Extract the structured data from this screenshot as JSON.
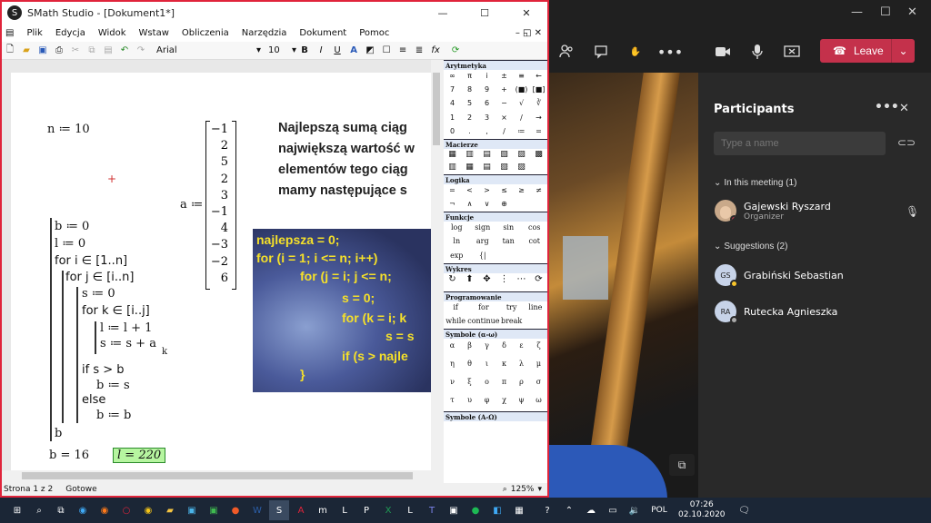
{
  "smath": {
    "title": "SMath Studio - [Dokument1*]",
    "menu": [
      "Plik",
      "Edycja",
      "Widok",
      "Wstaw",
      "Obliczenia",
      "Narzędzia",
      "Dokument",
      "Pomoc"
    ],
    "font_name": "Arial",
    "font_size": "10",
    "status_page": "Strona 1 z 2",
    "status_state": "Gotowe",
    "zoom": "125%",
    "math": {
      "n_def": "n ≔ 10",
      "a_label": "a ≔",
      "a_values": [
        "−1",
        "2",
        "5",
        "2",
        "3",
        "−1",
        "4",
        "−3",
        "−2",
        "6"
      ],
      "code": [
        "b ≔ 0",
        "l ≔ 0",
        "for  i ∈ [1..n]",
        "for  j ∈ [i..n]",
        "s ≔ 0",
        "for  k ∈ [i..j]",
        "l ≔ l + 1",
        "s ≔ s + a",
        "k",
        "if  s > b",
        "b ≔ s",
        "else",
        "b ≔ b",
        "b"
      ],
      "result_b": "b = 16",
      "result_l": "l = 220"
    },
    "slide_text": [
      "Najlepszą sumą ciąg",
      "największą wartość w",
      "elementów tego ciąg",
      "mamy następujące s"
    ],
    "slide_code": [
      "najlepsza = 0;",
      "for (i = 1; i <= n; i++)",
      "for (j = i; j <= n;",
      "s = 0;",
      "for (k = i; k",
      "s = s",
      "if (s > najle",
      "}"
    ],
    "palette": {
      "arytmetyka": {
        "title": "Arytmetyka",
        "rows": [
          "∞",
          "π",
          "i",
          "±",
          "≡",
          "←",
          "7",
          "8",
          "9",
          "+",
          "(■)",
          "[■]",
          "4",
          "5",
          "6",
          "−",
          "√",
          "∛",
          "1",
          "2",
          "3",
          "×",
          "∕",
          "→",
          "0",
          ".",
          ",",
          "∕",
          "≔",
          "="
        ]
      },
      "macierze": {
        "title": "Macierze"
      },
      "logika": {
        "title": "Logika",
        "rows": [
          "=",
          "<",
          ">",
          "≤",
          "≥",
          "≠",
          "¬",
          "∧",
          "∨",
          "⊕"
        ]
      },
      "funkcje": {
        "title": "Funkcje",
        "rows": [
          "log",
          "sign",
          "sin",
          "cos",
          "ln",
          "arg",
          "tan",
          "cot",
          "exp",
          "{|",
          "",
          ""
        ]
      },
      "wykres": {
        "title": "Wykres"
      },
      "programowanie": {
        "title": "Programowanie",
        "rows": [
          "if",
          "for",
          "try",
          "line",
          "while",
          "continue",
          "break"
        ]
      },
      "symbole_small": {
        "title": "Symbole (α-ω)",
        "rows": [
          "α",
          "β",
          "γ",
          "δ",
          "ε",
          "ζ",
          "η",
          "θ",
          "ι",
          "κ",
          "λ",
          "μ",
          "ν",
          "ξ",
          "ο",
          "π",
          "ρ",
          "σ",
          "τ",
          "υ",
          "φ",
          "χ",
          "ψ",
          "ω"
        ]
      },
      "symbole_big": {
        "title": "Symbole (Α-Ω)"
      }
    }
  },
  "teams": {
    "leave_label": "Leave",
    "panel_title": "Participants",
    "search_placeholder": "Type a name",
    "in_meeting_label": "In this meeting (1)",
    "suggestions_label": "Suggestions (2)",
    "participants": [
      {
        "name": "Gajewski Ryszard",
        "role": "Organizer"
      }
    ],
    "suggestions": [
      {
        "initials": "GS",
        "name": "Grabiński Sebastian"
      },
      {
        "initials": "RA",
        "name": "Rutecka Agnieszka"
      }
    ]
  },
  "taskbar": {
    "language": "POL",
    "time": "07:26",
    "date": "02.10.2020"
  },
  "colors": {
    "leave": "#c4314b",
    "smath_border": "#e0243b",
    "result_highlight": "#b6f5a0",
    "slide_code": "#f5e02a"
  }
}
